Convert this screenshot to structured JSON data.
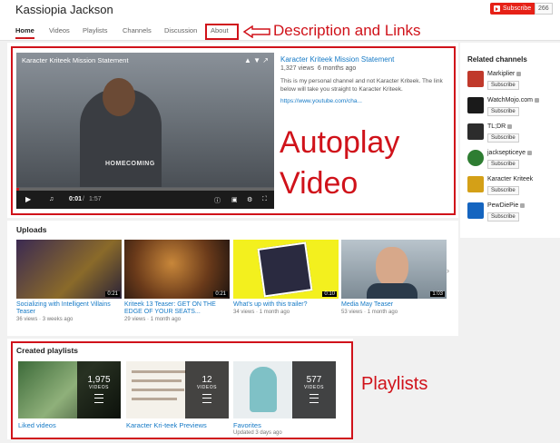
{
  "channel": {
    "name": "Kassiopia Jackson",
    "subscribe_label": "Subscribe",
    "subscriber_count": "266"
  },
  "tabs": [
    {
      "label": "Home",
      "active": true
    },
    {
      "label": "Videos"
    },
    {
      "label": "Playlists"
    },
    {
      "label": "Channels"
    },
    {
      "label": "Discussion"
    },
    {
      "label": "About"
    }
  ],
  "annotations": {
    "about": "Description and Links",
    "video_line1": "Autoplay",
    "video_line2": "Video",
    "playlists": "Playlists",
    "accent": "#d0121a"
  },
  "featured": {
    "player_title": "Karacter Kriteek Mission Statement",
    "shirt_text": "HOMECOMING",
    "time_current": "0:01",
    "time_total": "1:57",
    "progress": 0.01,
    "title": "Karacter Kriteek Mission Statement",
    "views": "1,327 views",
    "age": "6 months ago",
    "description": "This is my personal channel and not Karacter Kriteek. The link below will take you straight to Karacter Kriteek.",
    "link": "https://www.youtube.com/cha..."
  },
  "related": {
    "heading": "Related channels",
    "subscribe_label": "Subscribe",
    "channels": [
      {
        "name": "Markiplier",
        "color": "#c0392b"
      },
      {
        "name": "WatchMojo.com",
        "color": "#1a1a1a"
      },
      {
        "name": "TL;DR",
        "color": "#2c2c2c"
      },
      {
        "name": "jacksepticeye",
        "color": "#2e7d32"
      },
      {
        "name": "Karacter Kriteek",
        "color": "#d4a017"
      },
      {
        "name": "PewDiePie",
        "color": "#1565c0"
      }
    ]
  },
  "uploads": {
    "heading": "Uploads",
    "videos": [
      {
        "title": "Socializing with Intelligent Villains Teaser",
        "views": "36 views",
        "age": "3 weeks ago",
        "duration": "0:21"
      },
      {
        "title": "Kriteek 13 Teaser: GET ON THE EDGE OF YOUR SEATS...",
        "views": "29 views",
        "age": "1 month ago",
        "duration": "0:21"
      },
      {
        "title": "What's up with this trailer?",
        "views": "34 views",
        "age": "1 month ago",
        "duration": "0:10"
      },
      {
        "title": "Media May Teaser",
        "views": "53 views",
        "age": "1 month ago",
        "duration": "1:03"
      }
    ]
  },
  "playlists": {
    "heading": "Created playlists",
    "videos_label": "VIDEOS",
    "items": [
      {
        "title": "Liked videos",
        "count": "1,975",
        "meta": ""
      },
      {
        "title": "Karacter Kri-teek Previews",
        "count": "12",
        "meta": ""
      },
      {
        "title": "Favorites",
        "count": "577",
        "meta": "Updated 3 days ago"
      }
    ]
  }
}
